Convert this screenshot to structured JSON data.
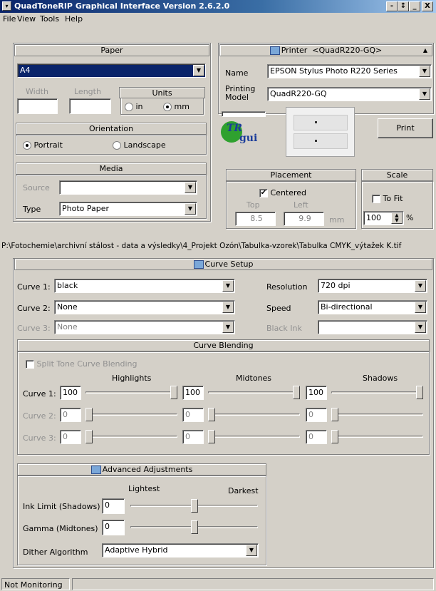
{
  "app": {
    "title": "QuadToneRIP Graphical Interface Version 2.6.2.0",
    "window_buttons": [
      "-",
      "↕",
      "_",
      "X"
    ]
  },
  "menu": [
    "File",
    "View",
    "Tools",
    "Help"
  ],
  "paper": {
    "header": "Paper",
    "size": "A4",
    "width_label": "Width",
    "length_label": "Length",
    "width": "",
    "length": "",
    "units_header": "Units",
    "unit_in": "in",
    "unit_mm": "mm",
    "selected_unit": "mm"
  },
  "orientation": {
    "header": "Orientation",
    "portrait": "Portrait",
    "landscape": "Landscape",
    "selected": "Portrait"
  },
  "media": {
    "header": "Media",
    "source_label": "Source",
    "source": "",
    "type_label": "Type",
    "type": "Photo Paper"
  },
  "printer": {
    "header": "Printer",
    "model_tag": "<QuadR220-GQ>",
    "name_label": "Name",
    "name": "EPSON Stylus Photo R220 Series",
    "model_label_1": "Printing",
    "model_label_2": "Model",
    "model": "QuadR220-GQ"
  },
  "logo": {
    "text_top": "TR",
    "text_bottom": "gui"
  },
  "print_button": "Print",
  "placement": {
    "header": "Placement",
    "centered_label": "Centered",
    "centered": true,
    "top_label": "Top",
    "left_label": "Left",
    "top": "8.5",
    "left": "9.9",
    "unit": "mm"
  },
  "scale": {
    "header": "Scale",
    "to_fit_label": "To Fit",
    "to_fit": false,
    "value": "100",
    "unit": "%"
  },
  "file_path": "P:\\Fotochemie\\archivní stálost - data a výsledky\\4_Projekt Ozón\\Tabulka-vzorek\\Tabulka CMYK_výtažek K.tif",
  "curve_setup": {
    "header": "Curve Setup",
    "curve1_label": "Curve 1:",
    "curve1": "black",
    "curve2_label": "Curve 2:",
    "curve2": "None",
    "curve3_label": "Curve 3:",
    "curve3": "None",
    "resolution_label": "Resolution",
    "resolution": "720 dpi",
    "speed_label": "Speed",
    "speed": "Bi-directional",
    "black_ink_label": "Black Ink",
    "black_ink": ""
  },
  "curve_blending": {
    "header": "Curve Blending",
    "split_label": "Split Tone Curve Blending",
    "highlights": "Highlights",
    "midtones": "Midtones",
    "shadows": "Shadows",
    "rows": [
      {
        "label": "Curve 1:",
        "h": "100",
        "m": "100",
        "s": "100",
        "h_pos": 1,
        "m_pos": 1,
        "s_pos": 1
      },
      {
        "label": "Curve 2:",
        "h": "0",
        "m": "0",
        "s": "0",
        "h_pos": 0,
        "m_pos": 0,
        "s_pos": 0
      },
      {
        "label": "Curve 3:",
        "h": "0",
        "m": "0",
        "s": "0",
        "h_pos": 0,
        "m_pos": 0,
        "s_pos": 0
      }
    ]
  },
  "advanced": {
    "header": "Advanced Adjustments",
    "lightest": "Lightest",
    "darkest": "Darkest",
    "ink_limit_label": "Ink Limit (Shadows)",
    "ink_limit": "0",
    "ink_limit_pos": 0.5,
    "gamma_label": "Gamma (Midtones)",
    "gamma": "0",
    "gamma_pos": 0.5,
    "dither_label": "Dither Algorithm",
    "dither": "Adaptive Hybrid"
  },
  "status": {
    "text": "Not Monitoring"
  }
}
